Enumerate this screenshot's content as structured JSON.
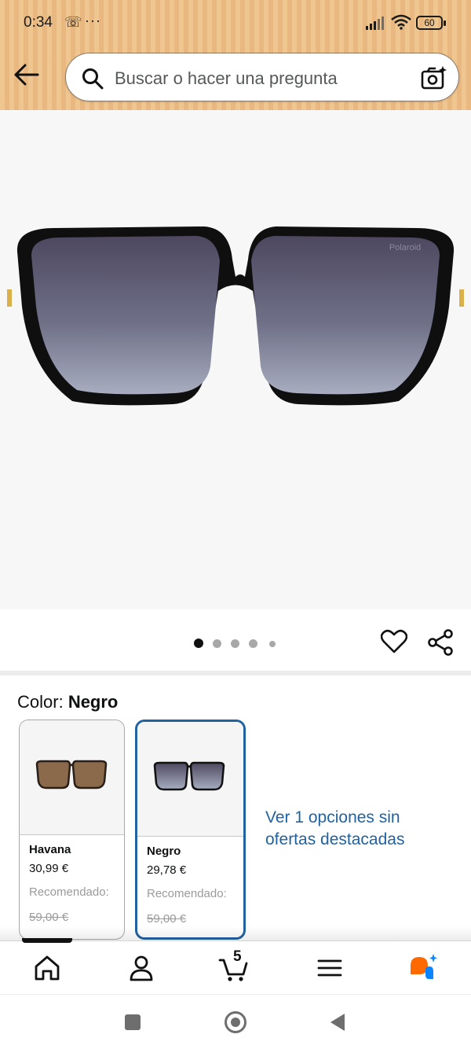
{
  "status_bar": {
    "time": "0:34",
    "battery": "60",
    "more": "···"
  },
  "search": {
    "placeholder": "Buscar o hacer una pregunta"
  },
  "product": {
    "brand_mark": "Polaroid",
    "image_count": 5,
    "active_image": 1
  },
  "color": {
    "label": "Color:",
    "selected": "Negro",
    "options": [
      {
        "name": "Havana",
        "price": "30,99 €",
        "recommended_label": "Recomendado:",
        "old_price": "59,00 €",
        "lens_color": "#8a6a4a",
        "selected": false
      },
      {
        "name": "Negro",
        "price": "29,78 €",
        "recommended_label": "Recomendado:",
        "old_price": "59,00 €",
        "lens_color": "#5a5a72",
        "selected": true
      }
    ],
    "more_options": "Ver 1 opciones sin ofertas destacadas"
  },
  "nav": {
    "cart_count": "5",
    "items": [
      "home-icon",
      "account-icon",
      "cart-icon",
      "menu-icon",
      "rufus-icon"
    ]
  },
  "colors": {
    "accent_blue": "#2162a1",
    "header_beige": "#f0c690",
    "rufus_orange": "#ff6a00",
    "rufus_blue": "#0a84ff"
  }
}
